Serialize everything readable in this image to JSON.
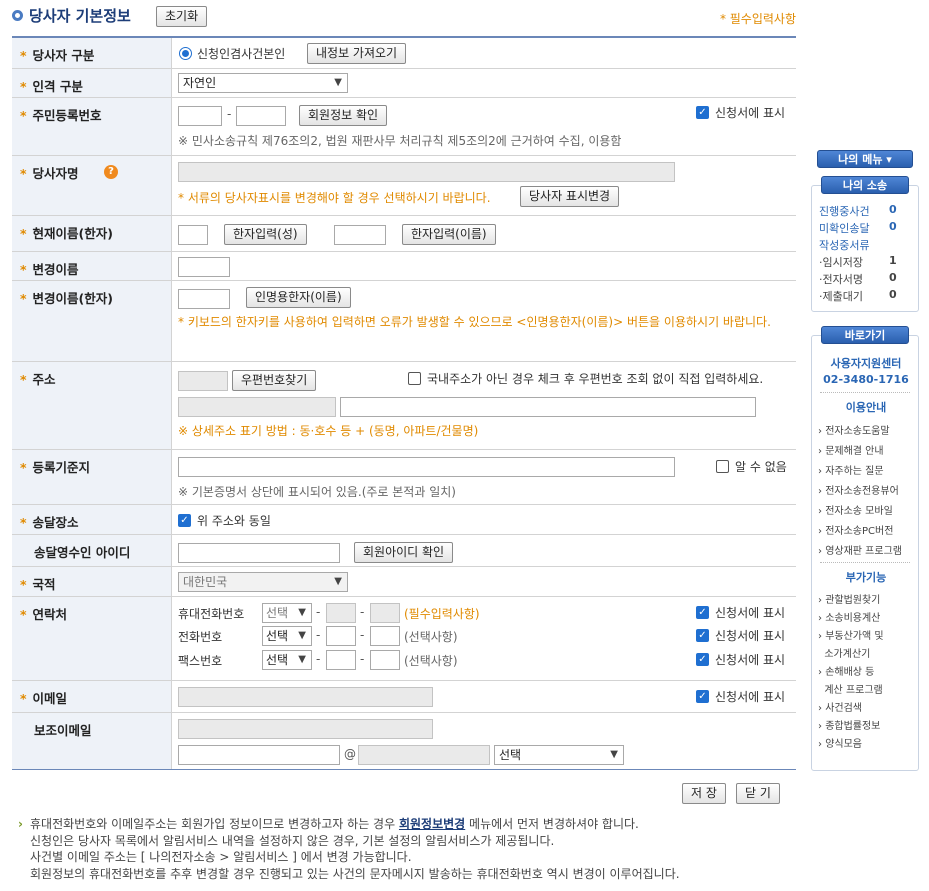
{
  "header": {
    "title": "당사자 기본정보",
    "reset_button": "초기화",
    "required_note": "* 필수입력사항"
  },
  "rows": {
    "party_type": {
      "label": "당사자 구분",
      "radio_label": "신청인겸사건본인",
      "load_button": "내정보 가져오기"
    },
    "person_type": {
      "label": "인격 구분",
      "selected": "자연인"
    },
    "rrn": {
      "label": "주민등록번호",
      "dash": "-",
      "verify_button": "회원정보 확인",
      "show_checkbox": "신청서에 표시",
      "note": "※ 민사소송규칙 제76조의2, 법원 재판사무 처리규칙 제5조의2에 근거하여 수집, 이용함"
    },
    "party_name": {
      "label": "당사자명",
      "help_icon": "?",
      "note": "* 서류의 당사자표시를 변경해야 할 경우 선택하시기 바랍니다.",
      "change_button": "당사자 표시변경"
    },
    "hanja_name": {
      "label": "현재이름(한자)",
      "surname_button": "한자입력(성)",
      "given_button": "한자입력(이름)"
    },
    "changed_name": {
      "label": "변경이름"
    },
    "changed_name_hanja": {
      "label": "변경이름(한자)",
      "button": "인명용한자(이름)",
      "note": "* 키보드의 한자키를 사용하여 입력하면 오류가 발생할 수 있으므로 <인명용한자(이름)> 버튼을 이용하시기 바랍니다."
    },
    "address": {
      "label": "주소",
      "zip_button": "우편번호찾기",
      "foreign_checkbox": "국내주소가 아닌 경우 체크 후 우편번호 조회 없이 직접 입력하세요.",
      "note": "※ 상세주소 표기 방법 : 동·호수 등 + (동명, 아파트/건물명)"
    },
    "registry": {
      "label": "등록기준지",
      "unknown_checkbox": "알 수 없음",
      "note": "※ 기본증명서 상단에 표시되어 있음.(주로 본적과 일치)"
    },
    "delivery": {
      "label": "송달장소",
      "same_checkbox": "위 주소와 동일"
    },
    "delivery_id": {
      "label": "송달영수인 아이디",
      "check_button": "회원아이디 확인"
    },
    "nationality": {
      "label": "국적",
      "selected": "대한민국"
    },
    "contact": {
      "label": "연락처",
      "items": [
        {
          "name": "휴대전화번호",
          "select": "선택",
          "hint": "(필수입력사항)",
          "show": "신청서에 표시"
        },
        {
          "name": "전화번호",
          "select": "선택",
          "hint": "(선택사항)",
          "show": "신청서에 표시"
        },
        {
          "name": "팩스번호",
          "select": "선택",
          "hint": "(선택사항)",
          "show": "신청서에 표시"
        }
      ]
    },
    "email": {
      "label": "이메일",
      "show_checkbox": "신청서에 표시"
    },
    "sub_email": {
      "label": "보조이메일",
      "at": "@",
      "domain_select": "선택"
    }
  },
  "buttons": {
    "save": "저 장",
    "close": "닫 기"
  },
  "footer": {
    "line1_pre": "휴대전화번호와 이메일주소는 회원가입 정보이므로 변경하고자 하는 경우",
    "line1_link": "회원정보변경",
    "line1_post": "메뉴에서 먼저 변경하셔야 합니다.",
    "line2": "신청인은 당사자 목록에서 알림서비스 내역을 설정하지 않은 경우, 기본 설정의 알림서비스가 제공됩니다.",
    "line3": "사건별 이메일 주소는 [ 나의전자소송 > 알림서비스 ] 에서 변경 가능합니다.",
    "line4": "회원정보의 휴대전화번호를 추후 변경할 경우 진행되고 있는 사건의 문자메시지 발송하는 휴대전화번호 역시 변경이 이루어집니다."
  },
  "sidebar": {
    "my_menu": "나의 메뉴",
    "my_cases": "나의 소송",
    "cases": [
      {
        "label": "진행중사건",
        "value": "0"
      },
      {
        "label": "미확인송달",
        "value": "0"
      },
      {
        "label": "작성중서류",
        "value": ""
      },
      {
        "label": "·임시저장",
        "value": "1"
      },
      {
        "label": "·전자서명",
        "value": "0"
      },
      {
        "label": "·제출대기",
        "value": "0"
      }
    ],
    "shortcut": "바로가기",
    "support_center": "사용자지원센터",
    "phone": "02-3480-1716",
    "usage_title": "이용안내",
    "usage_links": [
      "전자소송도움말",
      "문제해결 안내",
      "자주하는 질문",
      "전자소송전용뷰어",
      "전자소송 모바일",
      "전자소송PC버전",
      "영상재판 프로그램"
    ],
    "extra_title": "부가기능",
    "extra_links": [
      "관할법원찾기",
      "소송비용계산",
      "부동산가액 및",
      "소가계산기",
      "손해배상 등",
      "계산 프로그램",
      "사건검색",
      "종합법률정보",
      "양식모음"
    ]
  }
}
